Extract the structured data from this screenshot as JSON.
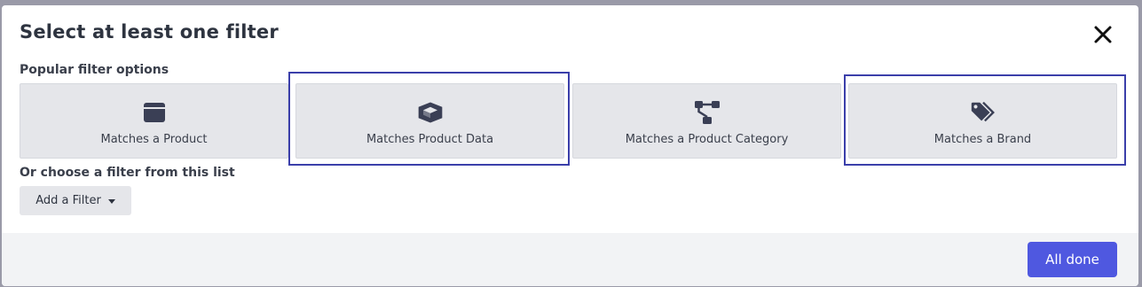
{
  "modal": {
    "title": "Select at least one filter",
    "close_icon": "close-icon"
  },
  "popular": {
    "label": "Popular filter options",
    "cards": [
      {
        "label": "Matches a Product",
        "icon": "box-icon",
        "highlighted": false
      },
      {
        "label": "Matches Product Data",
        "icon": "open-box-icon",
        "highlighted": true
      },
      {
        "label": "Matches a Product Category",
        "icon": "sitemap-icon",
        "highlighted": false
      },
      {
        "label": "Matches a Brand",
        "icon": "tags-icon",
        "highlighted": true
      }
    ]
  },
  "list": {
    "label": "Or choose a filter from this list",
    "add_filter_label": "Add a Filter",
    "caret_icon": "caret-down-icon"
  },
  "footer": {
    "done_label": "All done"
  },
  "colors": {
    "accent": "#4f58e0",
    "highlight_border": "#3b3faa",
    "card_bg": "#e5e6ea",
    "text_dark": "#2e3440"
  }
}
